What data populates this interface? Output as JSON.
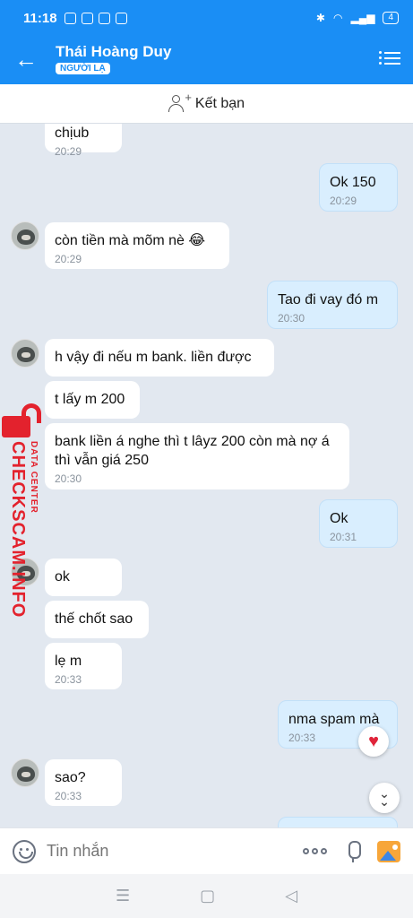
{
  "status_bar": {
    "time": "11:18",
    "battery": "4"
  },
  "header": {
    "contact_name": "Thái Hoàng Duy",
    "badge": "NGƯỜI LẠ"
  },
  "add_friend": {
    "label": "Kết bạn"
  },
  "messages": [
    {
      "dir": "in",
      "text": "chịub",
      "time": "20:29"
    },
    {
      "dir": "out",
      "text": "Ok 150",
      "time": "20:29"
    },
    {
      "dir": "in",
      "text": "còn tiền mà mõm nè 😂",
      "time": "20:29"
    },
    {
      "dir": "out",
      "text": "Tao đi vay đó m",
      "time": "20:30"
    },
    {
      "dir": "in",
      "text": "h vậy đi nếu m bank. liền được",
      "time": ""
    },
    {
      "dir": "in",
      "text": "t lấy m 200",
      "time": ""
    },
    {
      "dir": "in",
      "text": "bank liền á nghe thì t lâyz 200 còn mà nợ á thì vẫn giá 250",
      "time": "20:30"
    },
    {
      "dir": "out",
      "text": "Ok",
      "time": "20:31"
    },
    {
      "dir": "in",
      "text": "ok",
      "time": ""
    },
    {
      "dir": "in",
      "text": "thế chốt sao",
      "time": ""
    },
    {
      "dir": "in",
      "text": "lẹ m",
      "time": "20:33"
    },
    {
      "dir": "out",
      "text": "nma spam mà",
      "time": "20:33"
    },
    {
      "dir": "in",
      "text": "sao?",
      "time": "20:33"
    }
  ],
  "watermark": {
    "brand": "CHECKSCAM.INFO",
    "tagline": "DATA CENTER"
  },
  "composer": {
    "placeholder": "Tin nhắn"
  },
  "nav": {
    "recents": "☰",
    "home": "▢",
    "back": "◁"
  },
  "colors": {
    "brand": "#1a8ef5",
    "outgoing_bubble": "#d9eefe",
    "chat_bg": "#e2e8f0",
    "watermark": "#e3222d"
  }
}
